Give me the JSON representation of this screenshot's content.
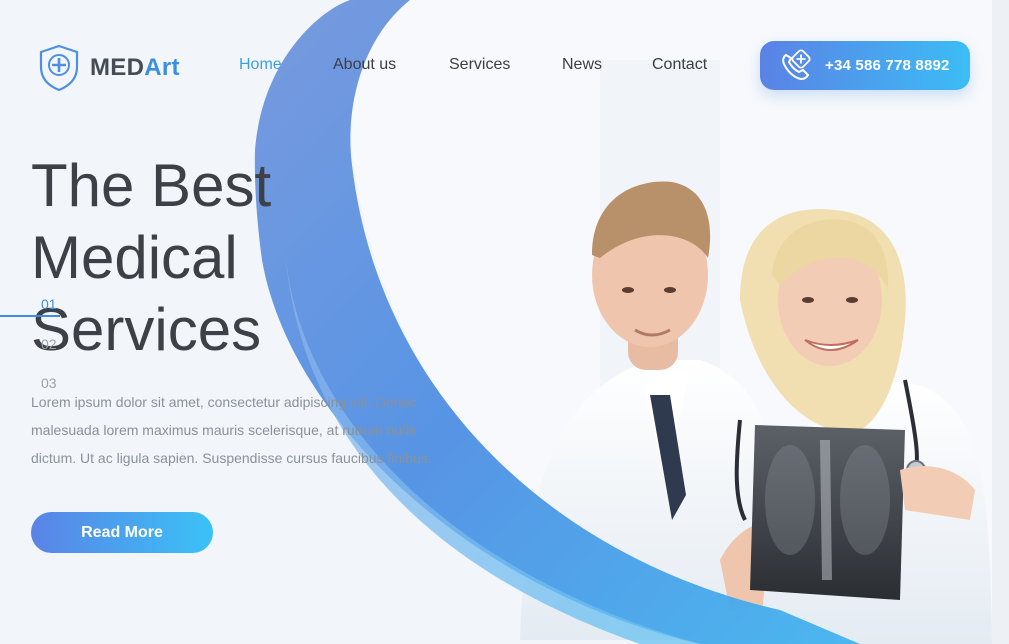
{
  "brand": {
    "name_part1": "MED",
    "name_part2": "Art",
    "logo_icon": "shield-plus-icon"
  },
  "nav": {
    "items": [
      {
        "label": "Home",
        "active": true
      },
      {
        "label": "About us",
        "active": false
      },
      {
        "label": "Services",
        "active": false
      },
      {
        "label": "News",
        "active": false
      },
      {
        "label": "Contact",
        "active": false
      }
    ]
  },
  "contact": {
    "phone": "+34 586 778 8892",
    "icon": "phone-plus-icon"
  },
  "hero": {
    "title_lines": [
      "The Best",
      "Medical",
      "Services"
    ],
    "description_lines": [
      "Lorem ipsum dolor sit amet, consectetur adipiscing elit. Donec",
      "malesuada lorem maximus mauris scelerisque, at rutrum nulla",
      "dictum. Ut ac ligula sapien. Suspendisse cursus faucibus finibus."
    ],
    "cta_label": "Read More",
    "slides": [
      "01",
      "02",
      "03"
    ],
    "active_slide": "01"
  },
  "colors": {
    "accent": "#3c8fe0",
    "gradient_start": "#5b82e6",
    "gradient_end": "#3bbdf5",
    "text_dark": "#3d4046",
    "text_muted": "#8a9199"
  }
}
